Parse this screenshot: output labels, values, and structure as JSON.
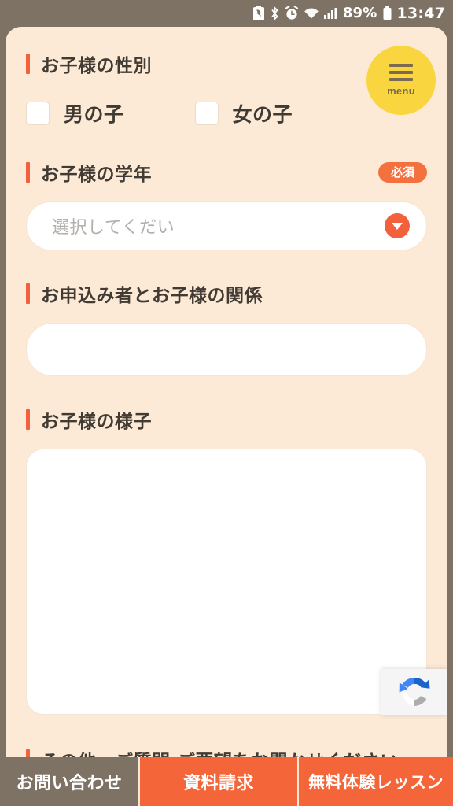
{
  "status_bar": {
    "battery_percent": "89%",
    "time": "13:47",
    "icons": [
      "battery-saver-icon",
      "bluetooth-icon",
      "alarm-icon",
      "wifi-icon",
      "signal-icon",
      "battery-icon"
    ]
  },
  "menu_button": {
    "label": "menu",
    "icon": "hamburger-icon",
    "color": "#f9d63f"
  },
  "form": {
    "accent_color": "#f2603c",
    "card_background": "#fcead7",
    "sections": [
      {
        "title": "お子様の性別",
        "required": false,
        "type": "checkbox",
        "options": [
          {
            "label": "男の子",
            "checked": false
          },
          {
            "label": "女の子",
            "checked": false
          }
        ]
      },
      {
        "title": "お子様の学年",
        "required": true,
        "required_label": "必須",
        "type": "select",
        "placeholder": "選択してくだい",
        "value": ""
      },
      {
        "title": "お申込み者とお子様の関係",
        "required": false,
        "type": "text",
        "placeholder": "",
        "value": ""
      },
      {
        "title": "お子様の様子",
        "required": false,
        "type": "textarea",
        "placeholder": "",
        "value": ""
      },
      {
        "title": "その他　ご質問・ご要望をお聞かせください",
        "required": false,
        "type": "heading"
      }
    ]
  },
  "recaptcha": {
    "name": "recaptcha-badge"
  },
  "bottom_nav": {
    "items": [
      {
        "label": "お問い合わせ",
        "color": "#7d7264",
        "active": true
      },
      {
        "label": "資料請求",
        "color": "#f4663a",
        "active": false
      },
      {
        "label": "無料体験レッスン",
        "color": "#f4663a",
        "active": false
      }
    ]
  }
}
